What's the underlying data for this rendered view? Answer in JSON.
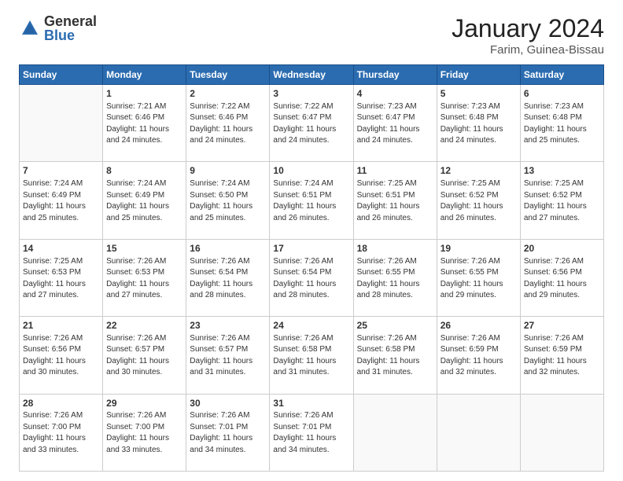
{
  "header": {
    "logo": {
      "general": "General",
      "blue": "Blue"
    },
    "title": "January 2024",
    "location": "Farim, Guinea-Bissau"
  },
  "days_of_week": [
    "Sunday",
    "Monday",
    "Tuesday",
    "Wednesday",
    "Thursday",
    "Friday",
    "Saturday"
  ],
  "weeks": [
    [
      {
        "day": "",
        "empty": true
      },
      {
        "day": "1",
        "sunrise": "7:21 AM",
        "sunset": "6:46 PM",
        "daylight": "11 hours and 24 minutes."
      },
      {
        "day": "2",
        "sunrise": "7:22 AM",
        "sunset": "6:46 PM",
        "daylight": "11 hours and 24 minutes."
      },
      {
        "day": "3",
        "sunrise": "7:22 AM",
        "sunset": "6:47 PM",
        "daylight": "11 hours and 24 minutes."
      },
      {
        "day": "4",
        "sunrise": "7:23 AM",
        "sunset": "6:47 PM",
        "daylight": "11 hours and 24 minutes."
      },
      {
        "day": "5",
        "sunrise": "7:23 AM",
        "sunset": "6:48 PM",
        "daylight": "11 hours and 24 minutes."
      },
      {
        "day": "6",
        "sunrise": "7:23 AM",
        "sunset": "6:48 PM",
        "daylight": "11 hours and 25 minutes."
      }
    ],
    [
      {
        "day": "7",
        "sunrise": "7:24 AM",
        "sunset": "6:49 PM",
        "daylight": "11 hours and 25 minutes."
      },
      {
        "day": "8",
        "sunrise": "7:24 AM",
        "sunset": "6:49 PM",
        "daylight": "11 hours and 25 minutes."
      },
      {
        "day": "9",
        "sunrise": "7:24 AM",
        "sunset": "6:50 PM",
        "daylight": "11 hours and 25 minutes."
      },
      {
        "day": "10",
        "sunrise": "7:24 AM",
        "sunset": "6:51 PM",
        "daylight": "11 hours and 26 minutes."
      },
      {
        "day": "11",
        "sunrise": "7:25 AM",
        "sunset": "6:51 PM",
        "daylight": "11 hours and 26 minutes."
      },
      {
        "day": "12",
        "sunrise": "7:25 AM",
        "sunset": "6:52 PM",
        "daylight": "11 hours and 26 minutes."
      },
      {
        "day": "13",
        "sunrise": "7:25 AM",
        "sunset": "6:52 PM",
        "daylight": "11 hours and 27 minutes."
      }
    ],
    [
      {
        "day": "14",
        "sunrise": "7:25 AM",
        "sunset": "6:53 PM",
        "daylight": "11 hours and 27 minutes."
      },
      {
        "day": "15",
        "sunrise": "7:26 AM",
        "sunset": "6:53 PM",
        "daylight": "11 hours and 27 minutes."
      },
      {
        "day": "16",
        "sunrise": "7:26 AM",
        "sunset": "6:54 PM",
        "daylight": "11 hours and 28 minutes."
      },
      {
        "day": "17",
        "sunrise": "7:26 AM",
        "sunset": "6:54 PM",
        "daylight": "11 hours and 28 minutes."
      },
      {
        "day": "18",
        "sunrise": "7:26 AM",
        "sunset": "6:55 PM",
        "daylight": "11 hours and 28 minutes."
      },
      {
        "day": "19",
        "sunrise": "7:26 AM",
        "sunset": "6:55 PM",
        "daylight": "11 hours and 29 minutes."
      },
      {
        "day": "20",
        "sunrise": "7:26 AM",
        "sunset": "6:56 PM",
        "daylight": "11 hours and 29 minutes."
      }
    ],
    [
      {
        "day": "21",
        "sunrise": "7:26 AM",
        "sunset": "6:56 PM",
        "daylight": "11 hours and 30 minutes."
      },
      {
        "day": "22",
        "sunrise": "7:26 AM",
        "sunset": "6:57 PM",
        "daylight": "11 hours and 30 minutes."
      },
      {
        "day": "23",
        "sunrise": "7:26 AM",
        "sunset": "6:57 PM",
        "daylight": "11 hours and 31 minutes."
      },
      {
        "day": "24",
        "sunrise": "7:26 AM",
        "sunset": "6:58 PM",
        "daylight": "11 hours and 31 minutes."
      },
      {
        "day": "25",
        "sunrise": "7:26 AM",
        "sunset": "6:58 PM",
        "daylight": "11 hours and 31 minutes."
      },
      {
        "day": "26",
        "sunrise": "7:26 AM",
        "sunset": "6:59 PM",
        "daylight": "11 hours and 32 minutes."
      },
      {
        "day": "27",
        "sunrise": "7:26 AM",
        "sunset": "6:59 PM",
        "daylight": "11 hours and 32 minutes."
      }
    ],
    [
      {
        "day": "28",
        "sunrise": "7:26 AM",
        "sunset": "7:00 PM",
        "daylight": "11 hours and 33 minutes."
      },
      {
        "day": "29",
        "sunrise": "7:26 AM",
        "sunset": "7:00 PM",
        "daylight": "11 hours and 33 minutes."
      },
      {
        "day": "30",
        "sunrise": "7:26 AM",
        "sunset": "7:01 PM",
        "daylight": "11 hours and 34 minutes."
      },
      {
        "day": "31",
        "sunrise": "7:26 AM",
        "sunset": "7:01 PM",
        "daylight": "11 hours and 34 minutes."
      },
      {
        "day": "",
        "empty": true
      },
      {
        "day": "",
        "empty": true
      },
      {
        "day": "",
        "empty": true
      }
    ]
  ]
}
